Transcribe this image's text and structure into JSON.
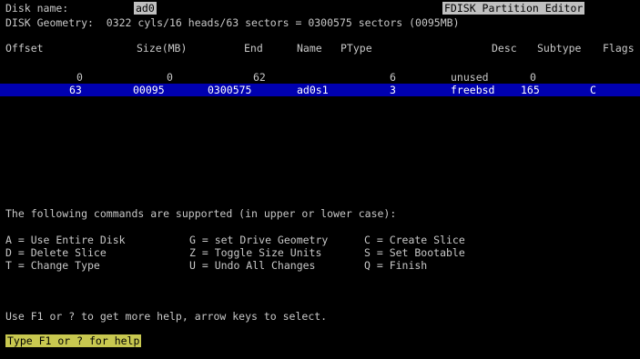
{
  "header": {
    "disk_name_label": "Disk name:",
    "disk_name_value": "ad0",
    "title": "FDISK Partition Editor",
    "geometry": "DISK Geometry:  0322 cyls/16 heads/63 sectors = 0300575 sectors (0095MB)"
  },
  "table": {
    "columns": [
      "Offset",
      "Size(MB)",
      "End",
      "Name",
      "PType",
      "Desc",
      "Subtype",
      "Flags"
    ],
    "rows": [
      {
        "offset": "0",
        "size": "0",
        "end": "62",
        "name": "",
        "ptype": "6",
        "desc": "unused",
        "subtype": "0",
        "flags": ""
      },
      {
        "offset": "63",
        "size": "00095",
        "end": "0300575",
        "name": "ad0s1",
        "ptype": "3",
        "desc": "freebsd",
        "subtype": "165",
        "flags": "C"
      }
    ]
  },
  "help": {
    "intro": "The following commands are supported (in upper or lower case):",
    "commands": [
      [
        "A = Use Entire Disk",
        "G = set Drive Geometry",
        "C = Create Slice"
      ],
      [
        "D = Delete Slice",
        "Z = Toggle Size Units",
        "S = Set Bootable"
      ],
      [
        "T = Change Type",
        "U = Undo All Changes",
        "Q = Finish"
      ]
    ],
    "hint": "Use F1 or ? to get more help, arrow keys to select."
  },
  "status": {
    "text": "Type F1 or ? for help"
  },
  "colors": {
    "background": "#000000",
    "selection": "#0000b0",
    "status_bar": "#c8c850",
    "title_highlight": "#c0c0c0"
  }
}
